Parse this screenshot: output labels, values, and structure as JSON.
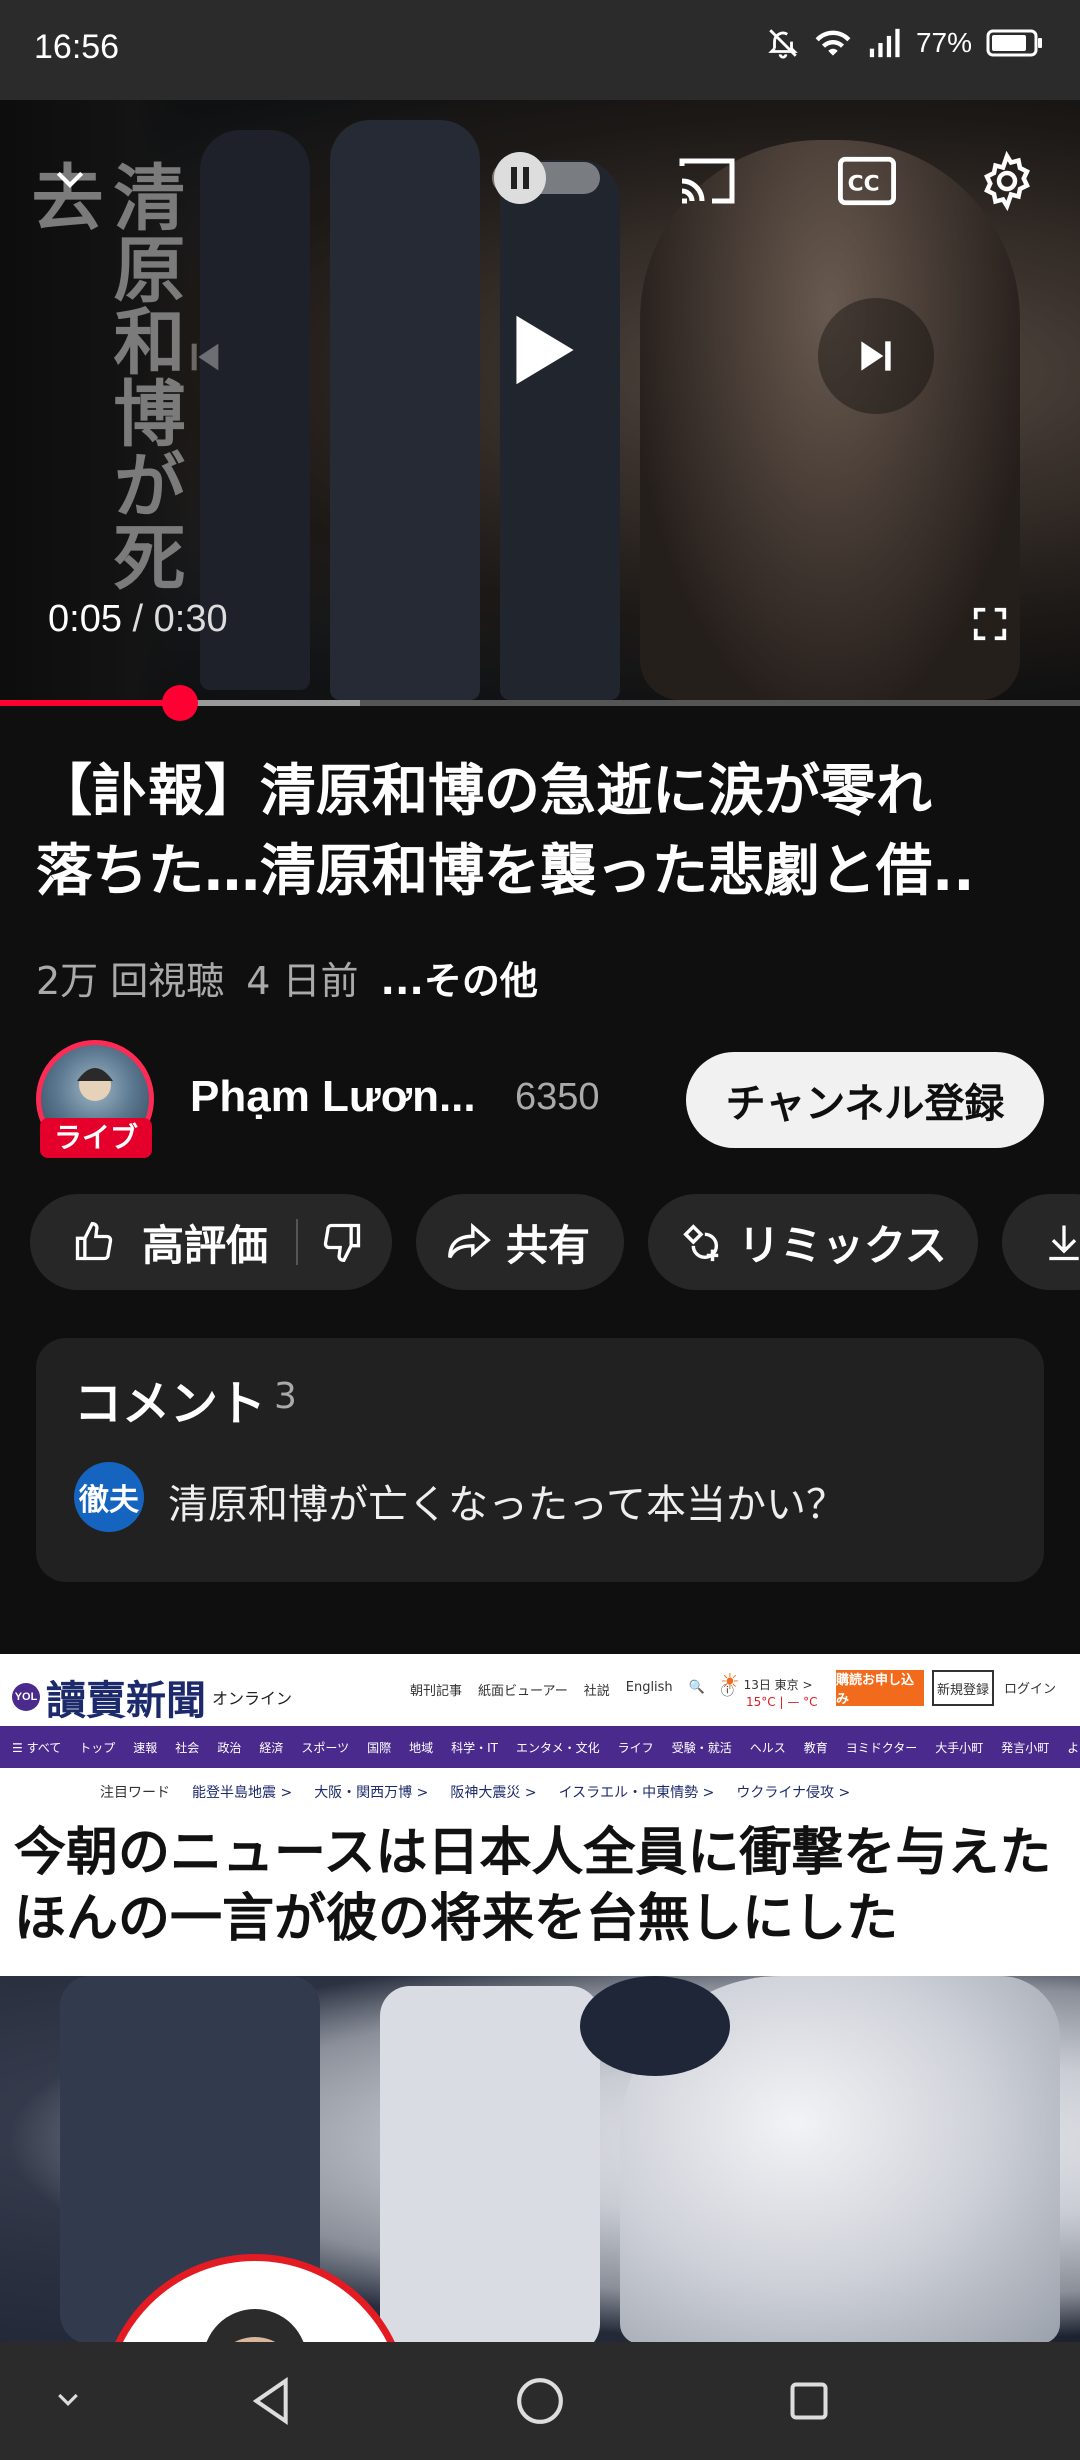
{
  "status_bar": {
    "time": "16:56",
    "battery": "77%",
    "icons": [
      "mute-bell-icon",
      "wifi-icon",
      "signal-icon",
      "battery-icon"
    ]
  },
  "player": {
    "overlay_text": "清原和博が死去",
    "current_time": "0:05",
    "separator": " / ",
    "duration": "0:30",
    "progress_fraction": 0.1667,
    "buffered_fraction": 0.333,
    "icons": [
      "collapse-chevron-icon",
      "autoplay-toggle-icon",
      "cast-icon",
      "cc-icon",
      "settings-icon",
      "previous-icon",
      "play-icon",
      "next-icon",
      "fullscreen-icon"
    ]
  },
  "video": {
    "title_line1": "【訃報】清原和博の急逝に涙が零れ",
    "title_line2": "落ちた…清原和博を襲った悲劇と借..",
    "views": "2万 回視聴",
    "age": "4 日前",
    "more": "...その他"
  },
  "channel": {
    "name": "Phạm Lươn...",
    "subscribers": "6350",
    "live_badge": "ライブ",
    "subscribe_label": "チャンネル登録"
  },
  "actions": {
    "like_label": "高評価",
    "share_label": "共有",
    "remix_label": "リミックス"
  },
  "comments": {
    "title": "コメント",
    "count": "3",
    "commenter_initials": "徹夫",
    "top_comment": "清原和博が亡くなったって本当かい？"
  },
  "ad": {
    "logo": "讀賣新聞",
    "logo_badge": "YOL",
    "logo_sub": "オンライン",
    "top_links": [
      "朝刊記事",
      "紙面ビューアー",
      "社説",
      "English"
    ],
    "weather": "13日 東京 >",
    "weather_temp": "15°C | — °C",
    "subscribe_btn": "購読お申し込み",
    "register_btn": "新規登録",
    "login": "ログイン",
    "nav": [
      "☰ すべて",
      "トップ",
      "速報",
      "社会",
      "政治",
      "経済",
      "スポーツ",
      "国際",
      "地域",
      "科学・IT",
      "エンタメ・文化",
      "ライフ",
      "受験・就活",
      "ヘルス",
      "教育",
      "ヨミドクター",
      "大手小町",
      "発言小町",
      "よみぽランド"
    ],
    "keywords": [
      "注目ワード",
      "能登半島地震 >",
      "大阪・関西万博 >",
      "阪神大震災 >",
      "イスラエル・中東情勢 >",
      "ウクライナ侵攻 >"
    ],
    "headline_line1": "今朝のニュースは日本人全員に衝撃を与えた",
    "headline_line2": "ほんの一言が彼の将来を台無しにした"
  },
  "navigation": {
    "icons": [
      "hide-keyboard-chevron-icon",
      "back-icon",
      "home-icon",
      "recents-icon"
    ]
  },
  "colors": {
    "accent_red": "#ff0033",
    "live_red": "#e4002b",
    "background": "#0f0f0f",
    "chip_bg": "#272727",
    "ad_purple": "#4b2a8e",
    "ad_orange": "#f26b1d"
  }
}
